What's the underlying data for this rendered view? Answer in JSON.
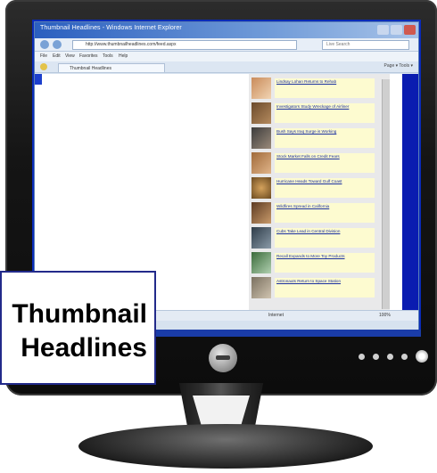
{
  "browser": {
    "title": "Thumbnail Headlines - Windows Internet Explorer",
    "address": "http://www.thumbnailheadlines.com/feed.aspx",
    "search_placeholder": "Live Search",
    "menu": [
      "File",
      "Edit",
      "View",
      "Favorites",
      "Tools",
      "Help"
    ],
    "tab_label": "Thumbnail Headlines",
    "tab_tools": "Page ▾  Tools ▾",
    "status_zone": "Internet",
    "status_zoom": "100%"
  },
  "headlines": [
    "Lindsay Lohan Returns to Rehab",
    "Investigators Study Wreckage of Airliner",
    "Bush Says Iraq Surge is Working",
    "Stock Market Falls on Credit Fears",
    "Hurricane Heads Toward Gulf Coast",
    "Wildfires Spread in California",
    "Cubs Take Lead in Central Division",
    "Recall Expands to More Toy Products",
    "Astronauts Return to Space Station",
    "Senate Debates New Energy Bill"
  ],
  "caption": {
    "line1": "Thumbnail",
    "line2": "Headlines"
  },
  "colors": {
    "screen_blue": "#0a2bb8",
    "headline_bg": "#fdfbd0",
    "caption_border": "#222a8a"
  }
}
